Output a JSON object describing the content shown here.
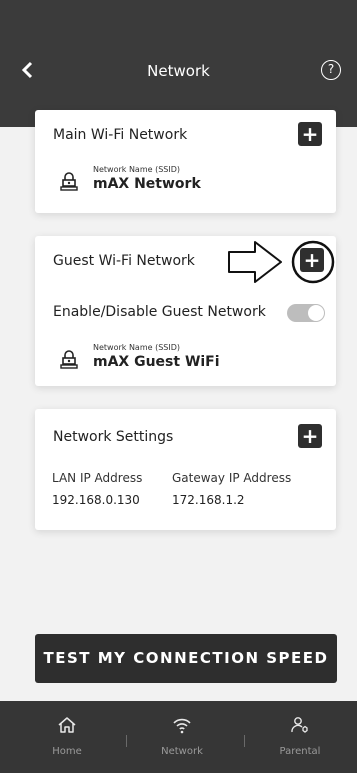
{
  "header": {
    "back_icon": "chevron-left-icon",
    "title": "Network",
    "help_icon": "help-circle-icon",
    "help_glyph": "?"
  },
  "main_wifi": {
    "title": "Main Wi-Fi Network",
    "add_glyph": "+",
    "ssid_label": "Network Name (SSID)",
    "ssid_value": "mAX Network"
  },
  "guest_wifi": {
    "title": "Guest Wi-Fi Network",
    "add_glyph": "+",
    "toggle_label": "Enable/Disable Guest Network",
    "toggle_on": true,
    "ssid_label": "Network Name (SSID)",
    "ssid_value": "mAX Guest WiFi"
  },
  "network_settings": {
    "title": "Network Settings",
    "add_glyph": "+",
    "lan_label": "LAN IP Address",
    "lan_value": "192.168.0.130",
    "gateway_label": "Gateway IP Address",
    "gateway_value": "172.168.1.2"
  },
  "speed_button": {
    "label": "TEST MY CONNECTION SPEED"
  },
  "tabbar": {
    "tabs": [
      {
        "label": "Home",
        "icon": "home-icon"
      },
      {
        "label": "Network",
        "icon": "wifi-icon"
      },
      {
        "label": "Parental",
        "icon": "parental-icon"
      }
    ]
  },
  "colors": {
    "header_bg": "#3b3b3b",
    "dark_button": "#2e2e2e",
    "tabbar_bg": "#363636",
    "page_bg": "#f2f2f2",
    "toggle_bg": "#bdbdbd"
  }
}
